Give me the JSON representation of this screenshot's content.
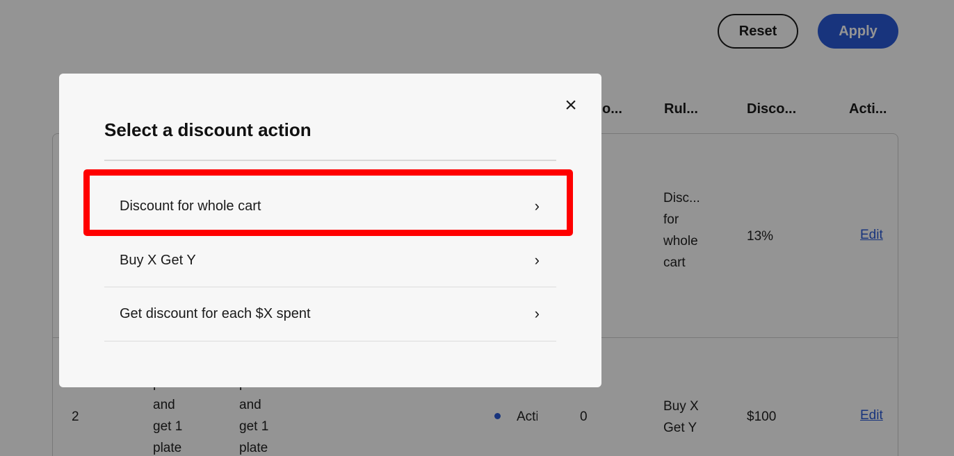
{
  "toolbar": {
    "reset_label": "Reset",
    "apply_label": "Apply"
  },
  "table": {
    "headers": [
      "o...",
      "Rul...",
      "Disco...",
      "Acti..."
    ],
    "rows": [
      {
        "rule_lines": [
          "Disc...",
          "for",
          "whole",
          "cart"
        ],
        "discount": "13%",
        "action": "Edit"
      },
      {
        "index": "2",
        "col1_lines": [
          "plates",
          "and",
          "get 1",
          "plate"
        ],
        "col2_lines": [
          "plates",
          "and",
          "get 1",
          "plate"
        ],
        "status": "Acti",
        "count": "0",
        "rule_lines": [
          "Buy X",
          "Get Y"
        ],
        "discount": "$100",
        "action": "Edit"
      }
    ]
  },
  "modal": {
    "title": "Select a discount action",
    "close_icon": "×",
    "options": [
      {
        "label": "Discount for whole cart",
        "chevron": "›"
      },
      {
        "label": "Buy X Get Y",
        "chevron": "›"
      },
      {
        "label": "Get discount for each $X spent",
        "chevron": "›"
      }
    ]
  },
  "colors": {
    "accent": "#2a5bd7",
    "highlight": "#ff0000",
    "overlay": "rgba(0,0,0,0.42)"
  }
}
